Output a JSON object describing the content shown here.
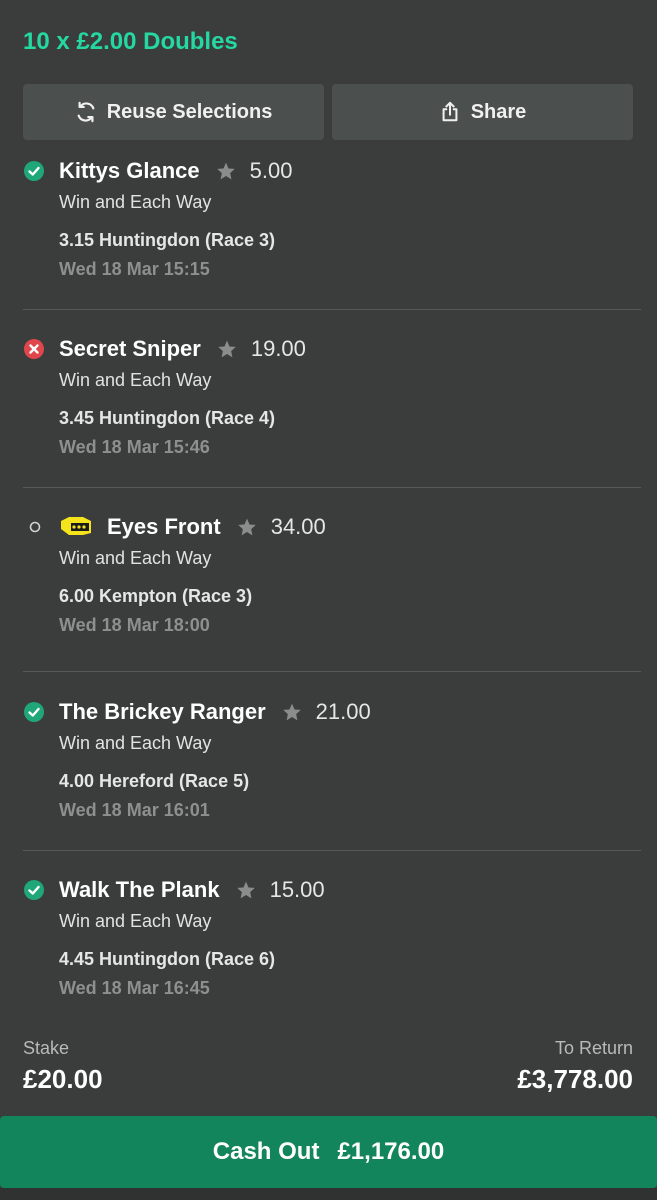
{
  "header": {
    "title": "10 x £2.00 Doubles"
  },
  "actions": {
    "reuse_label": "Reuse Selections",
    "share_label": "Share"
  },
  "selections": [
    {
      "status": "won",
      "name": "Kittys Glance",
      "odds": "5.00",
      "market": "Win and Each Way",
      "race": "3.15 Huntingdon (Race 3)",
      "time": "Wed 18 Mar 15:15",
      "has_silks": false
    },
    {
      "status": "lost",
      "name": "Secret Sniper",
      "odds": "19.00",
      "market": "Win and Each Way",
      "race": "3.45 Huntingdon (Race 4)",
      "time": "Wed 18 Mar 15:46",
      "has_silks": false
    },
    {
      "status": "open",
      "name": "Eyes Front",
      "odds": "34.00",
      "market": "Win and Each Way",
      "race": "6.00 Kempton (Race 3)",
      "time": "Wed 18 Mar 18:00",
      "has_silks": true
    },
    {
      "status": "won",
      "name": "The Brickey Ranger",
      "odds": "21.00",
      "market": "Win and Each Way",
      "race": "4.00 Hereford (Race 5)",
      "time": "Wed 18 Mar 16:01",
      "has_silks": false
    },
    {
      "status": "won",
      "name": "Walk The Plank",
      "odds": "15.00",
      "market": "Win and Each Way",
      "race": "4.45 Huntingdon (Race 6)",
      "time": "Wed 18 Mar 16:45",
      "has_silks": false
    }
  ],
  "summary": {
    "stake_label": "Stake",
    "stake_value": "£20.00",
    "return_label": "To Return",
    "return_value": "£3,778.00"
  },
  "cashout": {
    "label": "Cash Out",
    "amount": "£1,176.00"
  },
  "colors": {
    "accent": "#25d8a1",
    "won": "#1fa77a",
    "lost": "#e0474c",
    "cashout_bg": "#13855c"
  }
}
